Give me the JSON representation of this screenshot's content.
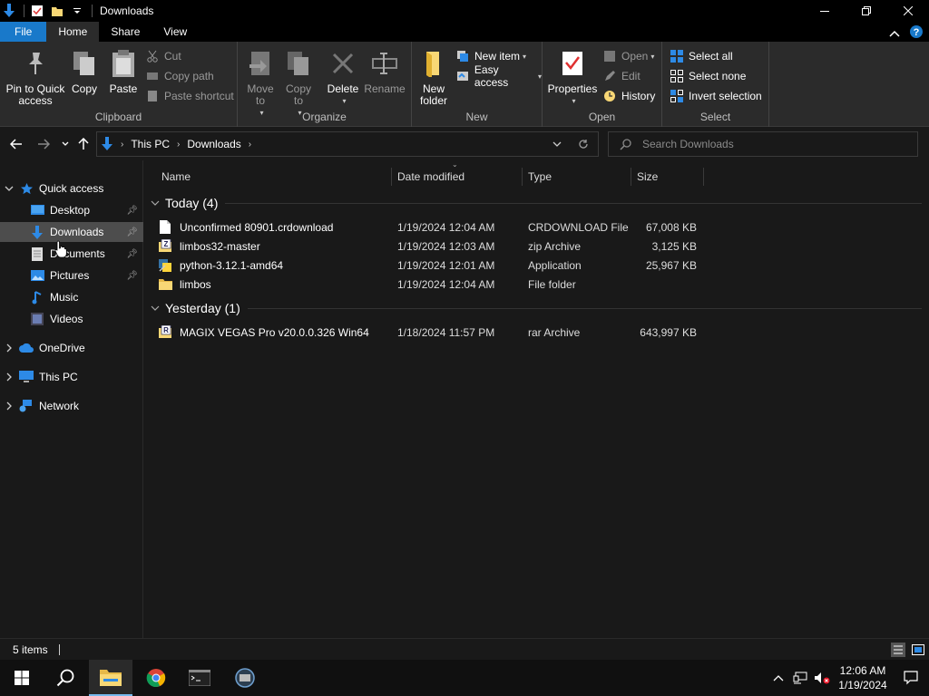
{
  "window": {
    "title": "Downloads"
  },
  "ribbon_tabs": [
    "File",
    "Home",
    "Share",
    "View"
  ],
  "ribbon": {
    "clipboard": {
      "label": "Clipboard",
      "pin": "Pin to Quick access",
      "copy": "Copy",
      "paste": "Paste",
      "cut": "Cut",
      "copy_path": "Copy path",
      "paste_shortcut": "Paste shortcut"
    },
    "organize": {
      "label": "Organize",
      "move_to": "Move to",
      "copy_to": "Copy to",
      "delete": "Delete",
      "rename": "Rename"
    },
    "new": {
      "label": "New",
      "new_folder": "New folder",
      "new_item": "New item",
      "easy_access": "Easy access"
    },
    "open": {
      "label": "Open",
      "properties": "Properties",
      "open": "Open",
      "edit": "Edit",
      "history": "History"
    },
    "select": {
      "label": "Select",
      "select_all": "Select all",
      "select_none": "Select none",
      "invert": "Invert selection"
    }
  },
  "address": {
    "crumbs": [
      "This PC",
      "Downloads"
    ],
    "search_placeholder": "Search Downloads"
  },
  "nav": {
    "quick_access": "Quick access",
    "items": [
      {
        "label": "Desktop",
        "icon": "desktop-icon",
        "pinned": true
      },
      {
        "label": "Downloads",
        "icon": "download-icon",
        "pinned": true,
        "selected": true
      },
      {
        "label": "Documents",
        "icon": "documents-icon",
        "pinned": true
      },
      {
        "label": "Pictures",
        "icon": "pictures-icon",
        "pinned": true
      },
      {
        "label": "Music",
        "icon": "music-icon",
        "pinned": false
      },
      {
        "label": "Videos",
        "icon": "videos-icon",
        "pinned": false
      }
    ],
    "onedrive": "OneDrive",
    "this_pc": "This PC",
    "network": "Network"
  },
  "columns": {
    "name": "Name",
    "date": "Date modified",
    "type": "Type",
    "size": "Size"
  },
  "groups": [
    {
      "title": "Today (4)",
      "files": [
        {
          "name": "Unconfirmed 80901.crdownload",
          "date": "1/19/2024 12:04 AM",
          "type": "CRDOWNLOAD File",
          "size": "67,008 KB",
          "icon": "file-icon"
        },
        {
          "name": "limbos32-master",
          "date": "1/19/2024 12:03 AM",
          "type": "zip Archive",
          "size": "3,125 KB",
          "icon": "zip-icon"
        },
        {
          "name": "python-3.12.1-amd64",
          "date": "1/19/2024 12:01 AM",
          "type": "Application",
          "size": "25,967 KB",
          "icon": "python-installer-icon"
        },
        {
          "name": "limbos",
          "date": "1/19/2024 12:04 AM",
          "type": "File folder",
          "size": "",
          "icon": "folder-icon"
        }
      ]
    },
    {
      "title": "Yesterday (1)",
      "files": [
        {
          "name": "MAGIX VEGAS Pro v20.0.0.326 Win64",
          "date": "1/18/2024 11:57 PM",
          "type": "rar Archive",
          "size": "643,997 KB",
          "icon": "rar-icon"
        }
      ]
    }
  ],
  "status": {
    "items": "5 items"
  },
  "taskbar": {
    "time": "12:06 AM",
    "date": "1/19/2024"
  },
  "colors": {
    "accent": "#1979ca",
    "folder": "#f8d775",
    "selected_nav": "#4d4d4d"
  }
}
